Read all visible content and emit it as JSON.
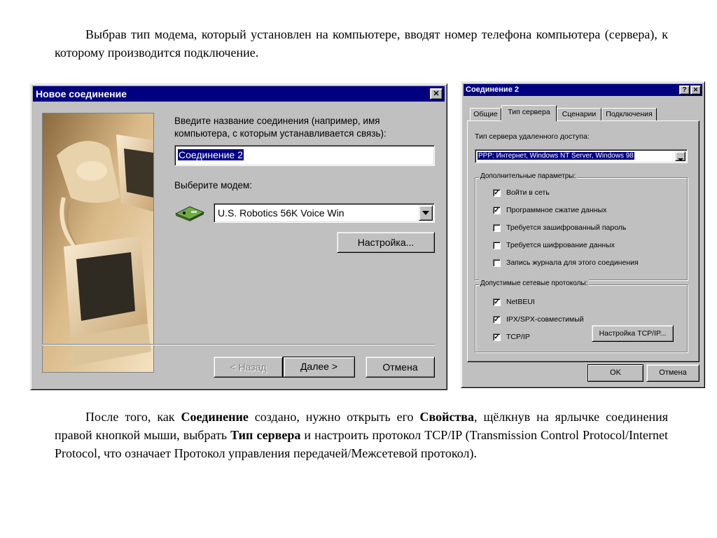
{
  "top_paragraph": "Выбрав тип модема, который установлен на компьютере, вводят номер телефона компьютера (сервера), к  которому производится подключение.",
  "bottom_paragraph": {
    "t1": "После того, как ",
    "b1": "Соединение",
    "t2": " создано, нужно открыть его ",
    "b2": "Свойства",
    "t3": ", щёлкнув на ярлычке соединения правой кнопкой мыши, выбрать ",
    "b3": "Тип сервера",
    "t4": " и настроить протокол TCP/IP (Transmission Control Protocol/Internet Protocol, что означает Протокол управления передачей/Межсетевой протокол)."
  },
  "wizard": {
    "title": "Новое соединение",
    "close_glyph": "✕",
    "prompt": "Введите название соединения (например, имя компьютера, с которым устанавливается связь):",
    "name_value": "Соединение 2",
    "modem_label": "Выберите модем:",
    "modem_value": "U.S. Robotics 56K Voice Win",
    "setup_button": "Настройка...",
    "back_button": "< Назад",
    "next_button": "Далее >",
    "cancel_button": "Отмена"
  },
  "props": {
    "title": "Соединение 2",
    "help_glyph": "?",
    "close_glyph": "✕",
    "tabs": [
      "Общие",
      "Тип сервера",
      "Сценарии",
      "Подключения"
    ],
    "server_type_label": "Тип сервера удаленного доступа:",
    "server_type_value": "PPP: Интернет, Windows NT Server, Windows 98",
    "advanced_legend": "Дополнительные параметры:",
    "advanced": [
      {
        "label": "Войти в сеть",
        "checked": true
      },
      {
        "label": "Программное сжатие данных",
        "checked": true
      },
      {
        "label": "Требуется зашифрованный пароль",
        "checked": false
      },
      {
        "label": "Требуется шифрование данных",
        "checked": false
      },
      {
        "label": "Запись журнала для этого соединения",
        "checked": false
      }
    ],
    "protocols_legend": "Допустимые сетевые протоколы:",
    "protocols": [
      {
        "label": "NetBEUI",
        "checked": true
      },
      {
        "label": "IPX/SPX-совместимый",
        "checked": true
      },
      {
        "label": "TCP/IP",
        "checked": true
      }
    ],
    "tcpip_button": "Настройка TCP/IP...",
    "ok_button": "OK",
    "cancel_button": "Отмена"
  }
}
